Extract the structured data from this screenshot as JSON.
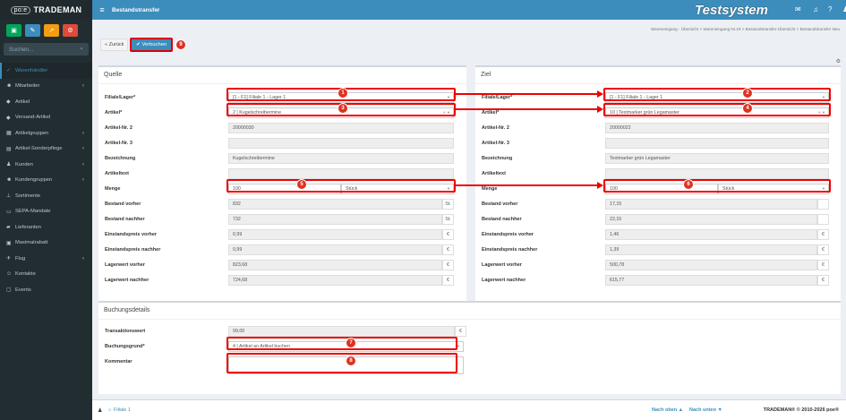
{
  "sidebar": {
    "logo_prefix": "po:e",
    "logo_text": "TRADEMAN",
    "search_placeholder": "Suchen...",
    "items": [
      {
        "label": "Warenhändler",
        "active": true
      },
      {
        "label": "Mitarbeiter",
        "chevron": true
      },
      {
        "label": "Artikel"
      },
      {
        "label": "Versand-Artikel"
      },
      {
        "label": "Artikelgruppen",
        "chevron": true
      },
      {
        "label": "Artikel-Sonderpflege",
        "chevron": true
      },
      {
        "label": "Kunden",
        "chevron": true
      },
      {
        "label": "Kundengruppen",
        "chevron": true
      },
      {
        "label": "Sortimente"
      },
      {
        "label": "SEPA-Mandate"
      },
      {
        "label": "Lieferanten"
      },
      {
        "label": "Maximalrabatt"
      },
      {
        "label": "Flug",
        "chevron": true
      },
      {
        "label": "Kontakte"
      },
      {
        "label": "Events"
      }
    ]
  },
  "topbar": {
    "page_title": "Bestandstransfer",
    "system_label": "Testsystem"
  },
  "breadcrumb": {
    "items": [
      "Wareneingang - Übersicht",
      "Wareneingang Nr.19",
      "Bestandstransfer-Übersicht",
      "Bestandstransfer Neu"
    ]
  },
  "toolbar": {
    "back_label": "« Zurück",
    "book_label": "✔ Verbuchen",
    "book_badge": "9"
  },
  "source": {
    "title": "Quelle",
    "labels": {
      "warehouse": "Filiale/Lager*",
      "article": "Artikel*",
      "article_no2": "Artikel-Nr. 2",
      "article_no3": "Artikel-Nr. 3",
      "designation": "Bezeichnung",
      "article_text": "Artikeltext",
      "quantity": "Menge",
      "stock_before": "Bestand vorher",
      "stock_after": "Bestand nachher",
      "price_before": "Einstandspreis vorher",
      "price_after": "Einstandspreis nachher",
      "value_before": "Lagerwert vorher",
      "value_after": "Lagerwert nachher"
    },
    "values": {
      "warehouse": "[1 - F1] Filiale 1 - Lager 1",
      "article": "2 | Kugelschreibermine",
      "article_no2": "20000030",
      "article_no3": "",
      "designation": "Kugelschreibermine",
      "article_text": "",
      "quantity": "100",
      "unit": "Stück",
      "stock_before": "832",
      "stock_after": "732",
      "stock_unit": "St.",
      "price_before": "0,99",
      "price_after": "0,99",
      "value_before": "823,68",
      "value_after": "724,68",
      "currency": "€"
    },
    "badges": {
      "warehouse": "1",
      "article": "3",
      "quantity": "5"
    }
  },
  "target": {
    "title": "Ziel",
    "labels": {
      "warehouse": "Filiale/Lager*",
      "article": "Artikel*",
      "article_no2": "Artikel-Nr. 2",
      "article_no3": "Artikel-Nr. 3",
      "designation": "Bezeichnung",
      "article_text": "Artikeltext",
      "quantity": "Menge",
      "stock_before": "Bestand vorher",
      "stock_after": "Bestand nachher",
      "price_before": "Einstandspreis vorher",
      "price_after": "Einstandspreis nachher",
      "value_before": "Lagerwert vorher",
      "value_after": "Lagerwert nachher"
    },
    "values": {
      "warehouse": "[1 - F1] Filiale 1 - Lager 1",
      "article": "10 | Textmarker grün Legamaster",
      "article_no2": "20000022",
      "article_no3": "",
      "designation": "Textmarker grün Legamaster",
      "article_text": "",
      "quantity": "100",
      "unit": "Stück",
      "stock_before": "17,15",
      "stock_after": "22,15",
      "price_before": "1,46",
      "price_after": "1,39",
      "value_before": "500,78",
      "value_after": "615,77",
      "currency": "€"
    },
    "badges": {
      "warehouse": "2",
      "article": "4",
      "quantity": "6"
    }
  },
  "booking": {
    "title": "Buchungsdetails",
    "labels": {
      "transaction_value": "Transaktionswert",
      "reason": "Buchungsgrund*",
      "comment": "Kommentar"
    },
    "values": {
      "transaction_value": "99,00",
      "currency": "€",
      "reason": "4 | Artikel an Artikel buchen",
      "comment": ""
    },
    "badges": {
      "reason": "7",
      "comment": "8"
    }
  },
  "footer": {
    "branch": "Filiale 1",
    "nav_up": "Nach oben ▲",
    "nav_down": "Nach unten ▼",
    "copyright": "TRADEMAN® © 2010-2026 poe®"
  },
  "colors": {
    "primary": "#3c8dbc",
    "sidebar": "#222d32",
    "annotation": "#e00000"
  }
}
